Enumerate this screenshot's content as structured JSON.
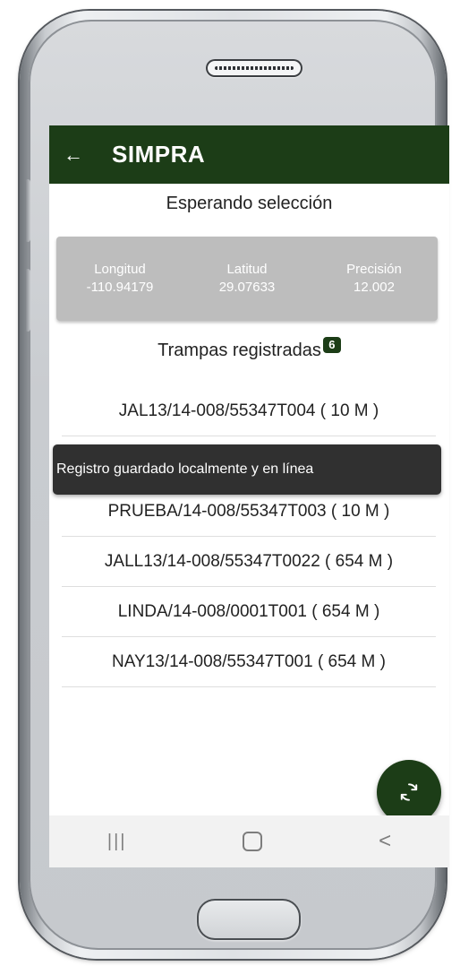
{
  "appbar": {
    "title": "SIMPRA",
    "back_icon": "arrow-left-icon"
  },
  "status": {
    "text": "Esperando selección"
  },
  "gps": {
    "longitude_label": "Longitud",
    "longitude_value": "-110.94179",
    "latitude_label": "Latitud",
    "latitude_value": "29.07633",
    "precision_label": "Precisión",
    "precision_value": "12.002"
  },
  "traps": {
    "header": "Trampas registradas",
    "count": "6",
    "items": [
      {
        "label": "JAL13/14-008/55347T004 ( 10 M )"
      },
      {
        "label": "PRUEBA/14-008/55347T003 ( 10 M )"
      },
      {
        "label": "JALL13/14-008/55347T0022 ( 654 M )"
      },
      {
        "label": "LINDA/14-008/0001T001 ( 654 M )"
      },
      {
        "label": "NAY13/14-008/55347T001 ( 654 M )"
      }
    ]
  },
  "toast": {
    "text": "Registro guardado localmente y en línea"
  },
  "fab": {
    "icon": "sync-icon"
  },
  "sysnav": {
    "recent": "|||",
    "back": "<"
  },
  "colors": {
    "primary": "#1c3d17",
    "card": "#bdbdbd",
    "toast": "#303030"
  }
}
